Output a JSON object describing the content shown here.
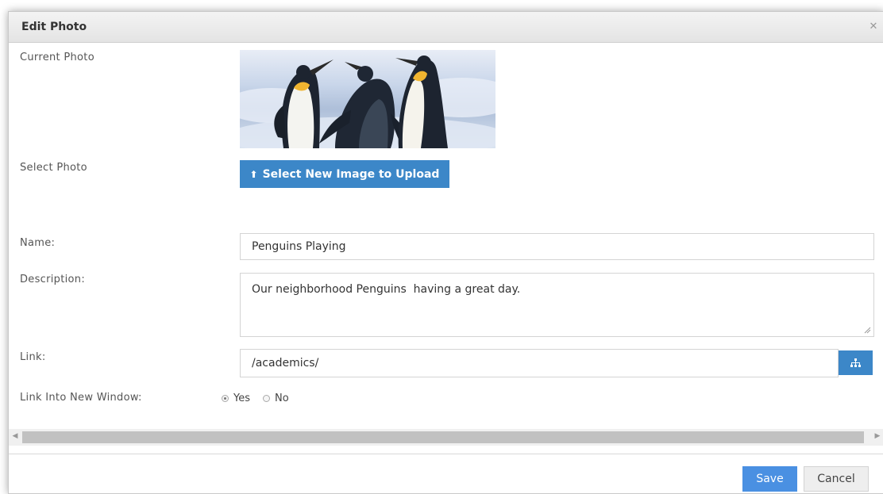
{
  "dialog": {
    "title": "Edit Photo",
    "close_icon": "close-icon"
  },
  "labels": {
    "current_photo": "Current Photo",
    "select_photo": "Select Photo",
    "name": "Name:",
    "description": "Description:",
    "link": "Link:",
    "link_new_window": "Link Into New Window:"
  },
  "upload": {
    "label": "Select New Image to Upload",
    "icon": "upload-icon"
  },
  "fields": {
    "name_value": "Penguins Playing",
    "description_value": "Our neighborhood Penguins  having a great day.",
    "link_value": "/academics/",
    "link_button_icon": "sitemap-icon"
  },
  "link_new_window": {
    "options": [
      {
        "label": "Yes",
        "selected": true
      },
      {
        "label": "No",
        "selected": false
      }
    ]
  },
  "footer": {
    "save_label": "Save",
    "cancel_label": "Cancel"
  },
  "colors": {
    "primary": "#3c87c8",
    "save": "#4a90e2"
  }
}
